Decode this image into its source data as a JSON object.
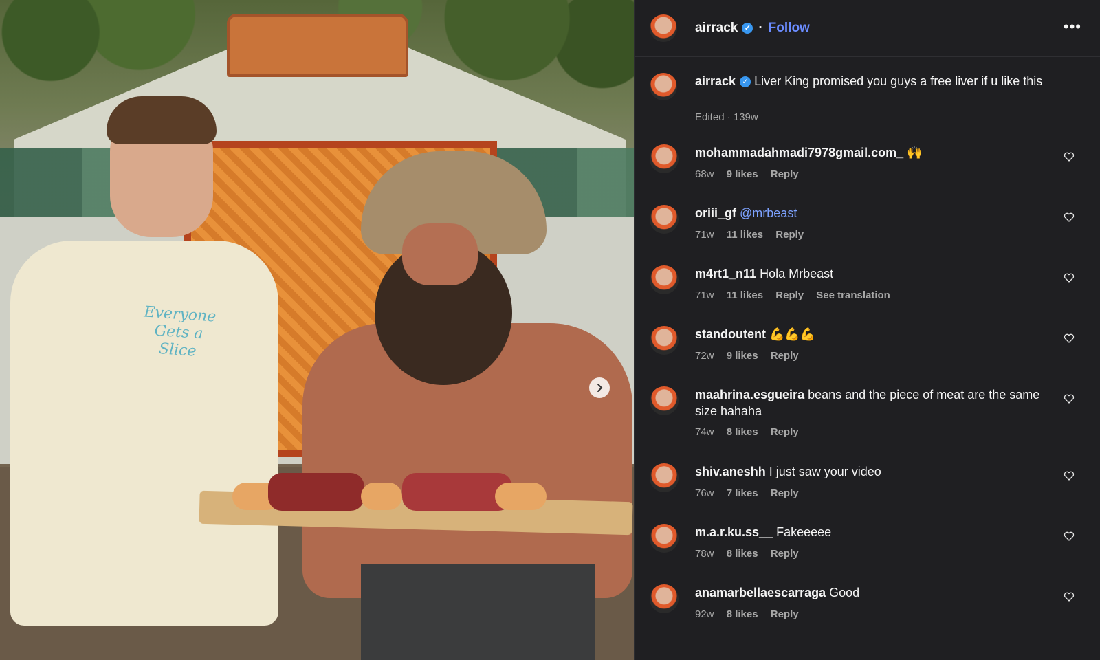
{
  "post": {
    "username": "airrack",
    "follow_label": "Follow",
    "more_label": "•••",
    "shirt_print": "Everyone Gets a Slice"
  },
  "caption": {
    "username": "airrack",
    "text": "Liver King promised you guys a free liver if u like this",
    "meta": "Edited · 139w"
  },
  "comments": [
    {
      "user": "mohammadahmadi7978gmail.com_",
      "text": "🙌",
      "age": "68w",
      "likes": "9 likes",
      "reply": "Reply"
    },
    {
      "user": "oriii_gf",
      "text": "@mrbeast",
      "age": "71w",
      "likes": "11 likes",
      "reply": "Reply",
      "mention": true
    },
    {
      "user": "m4rt1_n11",
      "text": "Hola Mrbeast",
      "age": "71w",
      "likes": "11 likes",
      "reply": "Reply",
      "extra": "See translation"
    },
    {
      "user": "standoutent",
      "text": "💪💪💪",
      "age": "72w",
      "likes": "9 likes",
      "reply": "Reply"
    },
    {
      "user": "maahrina.esgueira",
      "text": "beans and the piece of meat are the same size hahaha",
      "age": "74w",
      "likes": "8 likes",
      "reply": "Reply"
    },
    {
      "user": "shiv.aneshh",
      "text": "I just saw your video",
      "age": "76w",
      "likes": "7 likes",
      "reply": "Reply"
    },
    {
      "user": "m.a.r.ku.ss__",
      "text": "Fakeeeee",
      "age": "78w",
      "likes": "8 likes",
      "reply": "Reply"
    },
    {
      "user": "anamarbellaescarraga",
      "text": "Good",
      "age": "92w",
      "likes": "8 likes",
      "reply": "Reply"
    }
  ],
  "colors": {
    "accent": "#6b8cff",
    "verified": "#3897f0",
    "background": "#1f1f22",
    "muted": "#a8a8a8"
  },
  "icons": {
    "next": "chevron-right-icon",
    "heart": "heart-icon",
    "verified": "verified-badge-icon",
    "more": "more-icon"
  }
}
